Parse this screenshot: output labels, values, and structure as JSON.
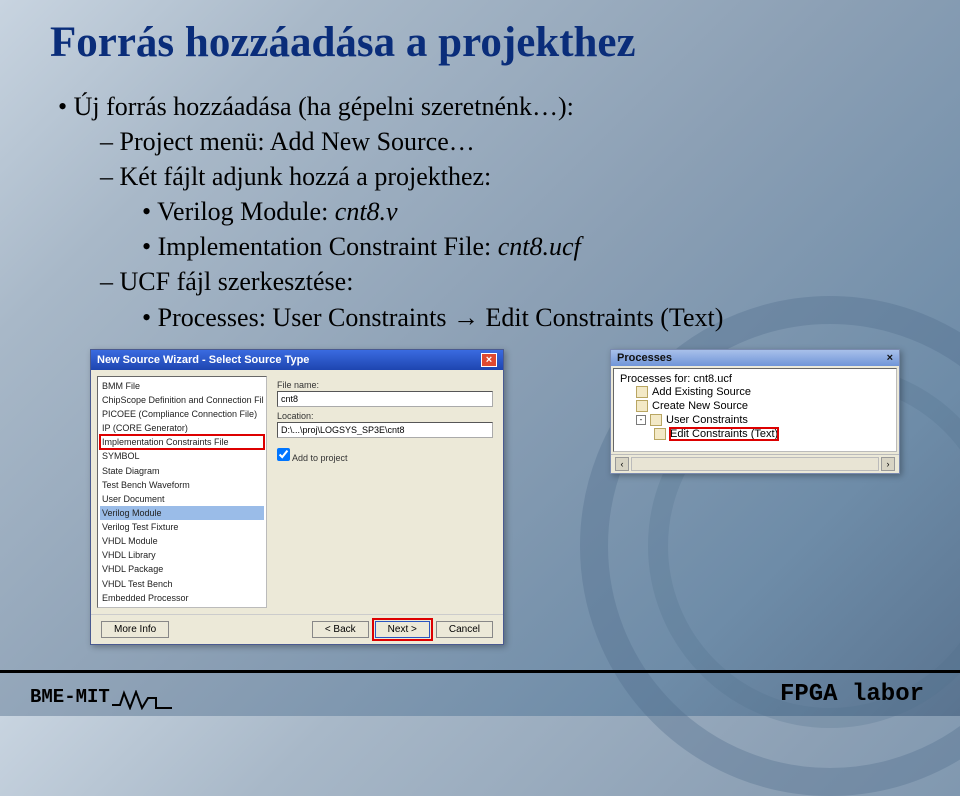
{
  "title": "Forrás hozzáadása a projekthez",
  "bullets": {
    "b1": "Új forrás hozzáadása (ha gépelni szeretnénk…):",
    "b2a": "Project menü: Add New Source…",
    "b2b": "Két fájlt adjunk hozzá a projekthez:",
    "b3a_pre": "Verilog Module: ",
    "b3a_em": "cnt8.v",
    "b3b_pre": "Implementation Constraint File: ",
    "b3b_em": "cnt8.ucf",
    "b2c": "UCF fájl szerkesztése:",
    "b3c": "Processes: User Constraints → Edit Constraints (Text)"
  },
  "wizard": {
    "title": "New Source Wizard - Select Source Type",
    "items": [
      "BMM File",
      "ChipScope Definition and Connection File",
      "PICOEE (Compliance Connection File)",
      "IP (CORE Generator)",
      "Implementation Constraints File",
      "SYMBOL",
      "State Diagram",
      "Test Bench Waveform",
      "User Document",
      "Verilog Module",
      "Verilog Test Fixture",
      "VHDL Module",
      "VHDL Library",
      "VHDL Package",
      "VHDL Test Bench",
      "Embedded Processor"
    ],
    "sel_red_idx": 4,
    "sel_blue_idx": 9,
    "filename_lbl": "File name:",
    "filename_val": "cnt8",
    "location_lbl": "Location:",
    "location_val": "D:\\...\\proj\\LOGSYS_SP3E\\cnt8",
    "add_chk": "Add to project",
    "btns": {
      "more": "More Info",
      "back": "< Back",
      "next": "Next >",
      "cancel": "Cancel"
    }
  },
  "processes": {
    "title": "Processes",
    "subtitle": "Processes for: cnt8.ucf",
    "items": [
      {
        "label": "Add Existing Source",
        "level": 1
      },
      {
        "label": "Create New Source",
        "level": 1
      },
      {
        "label": "User Constraints",
        "level": 1,
        "expand": "-"
      },
      {
        "label": "Edit Constraints (Text)",
        "level": 2,
        "sel": true
      }
    ]
  },
  "footer": {
    "left": "BME-MIT",
    "right": "FPGA labor"
  }
}
